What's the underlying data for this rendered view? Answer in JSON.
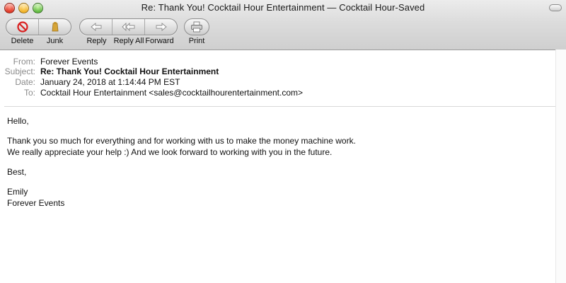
{
  "window": {
    "title": "Re: Thank You! Cocktail Hour Entertainment — Cocktail Hour-Saved"
  },
  "toolbar": {
    "delete_label": "Delete",
    "junk_label": "Junk",
    "reply_label": "Reply",
    "reply_all_label": "Reply All",
    "forward_label": "Forward",
    "print_label": "Print",
    "icons": {
      "delete": "no-entry-icon",
      "junk": "trash-bag-icon",
      "reply": "arrow-left-icon",
      "reply_all": "double-arrow-left-icon",
      "forward": "arrow-right-icon",
      "print": "printer-icon"
    },
    "colors": {
      "delete_icon": "#d91f1f",
      "junk_icon": "#d6a437"
    }
  },
  "headers": {
    "from_label": "From:",
    "from_value": "Forever Events",
    "subject_label": "Subject:",
    "subject_value": "Re: Thank You! Cocktail Hour Entertainment",
    "date_label": "Date:",
    "date_value": "January 24, 2018 at 1:14:44 PM EST",
    "to_label": "To:",
    "to_value": "Cocktail Hour Entertainment <sales@cocktailhourentertainment.com>"
  },
  "message": {
    "greeting": "Hello,",
    "line1": "Thank you so much for everything and for working with us to make the money machine work.",
    "line2": "We really appreciate your help :) And we look forward to working with you in the future.",
    "signoff": "Best,",
    "sender_name": "Emily",
    "sender_company": "Forever Events"
  }
}
